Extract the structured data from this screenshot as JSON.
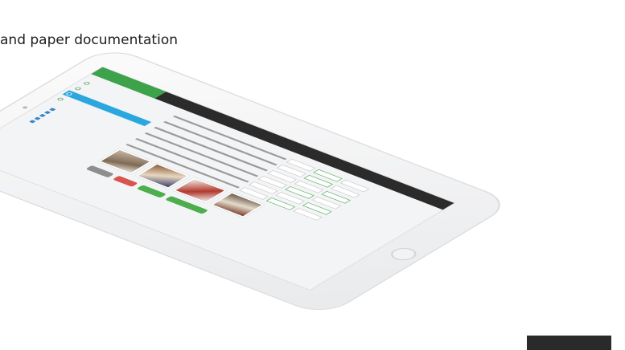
{
  "caption": "and paper documentation",
  "app": {
    "brand": "",
    "nav": [
      "",
      "",
      "",
      "",
      ""
    ],
    "sidebar_title": "",
    "steps": [
      "",
      "",
      "",
      ""
    ],
    "links": [
      "",
      "",
      "",
      "",
      ""
    ],
    "section_title": "",
    "gallery_title": "",
    "buttons": [
      "",
      "",
      "",
      ""
    ],
    "powered": ""
  },
  "colors": {
    "brand_green": "#3ca34a",
    "accent_blue": "#2aa7df",
    "danger_red": "#d9534f",
    "topbar": "#2b2b2b"
  }
}
